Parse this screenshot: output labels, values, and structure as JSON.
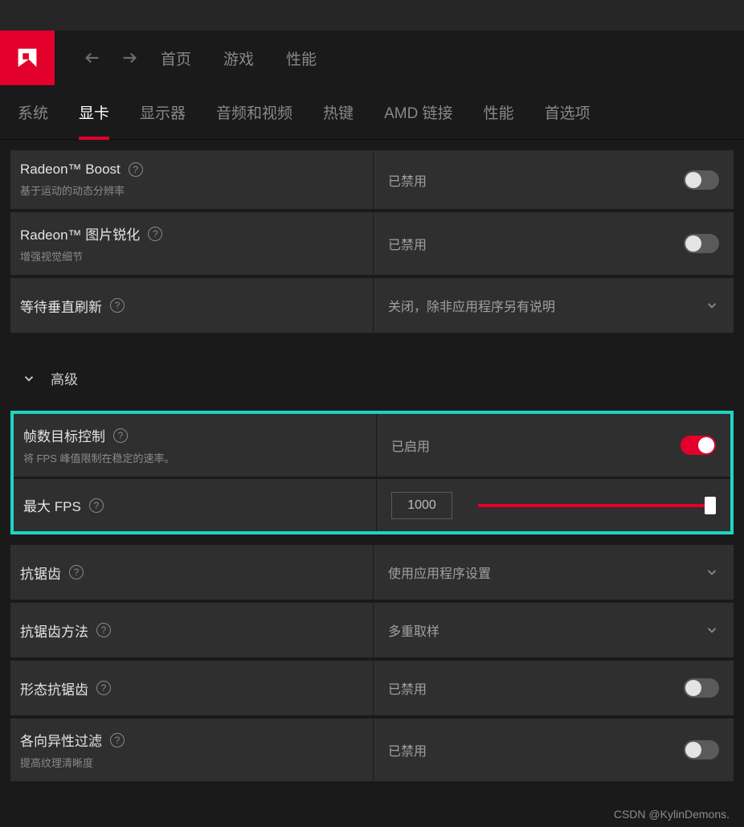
{
  "nav": {
    "items": [
      "首页",
      "游戏",
      "性能"
    ]
  },
  "tabs": [
    "系统",
    "显卡",
    "显示器",
    "音频和视频",
    "热键",
    "AMD 链接",
    "性能",
    "首选项"
  ],
  "rows": {
    "boost": {
      "title": "Radeon™ Boost",
      "desc": "基于运动的动态分辨率",
      "value": "已禁用"
    },
    "sharpen": {
      "title": "Radeon™ 图片锐化",
      "desc": "增强视觉细节",
      "value": "已禁用"
    },
    "vsync": {
      "title": "等待垂直刷新",
      "value": "关闭，除非应用程序另有说明"
    },
    "advanced": "高级",
    "frtc": {
      "title": "帧数目标控制",
      "desc": "将 FPS 峰值限制在稳定的速率。",
      "value": "已启用"
    },
    "maxfps": {
      "title": "最大 FPS",
      "input": "1000"
    },
    "aa": {
      "title": "抗锯齿",
      "value": "使用应用程序设置"
    },
    "aamethod": {
      "title": "抗锯齿方法",
      "value": "多重取样"
    },
    "morphaa": {
      "title": "形态抗锯齿",
      "value": "已禁用"
    },
    "aniso": {
      "title": "各向异性过滤",
      "desc": "提高纹理清晰度",
      "value": "已禁用"
    }
  },
  "watermark": "CSDN @KylinDemons."
}
